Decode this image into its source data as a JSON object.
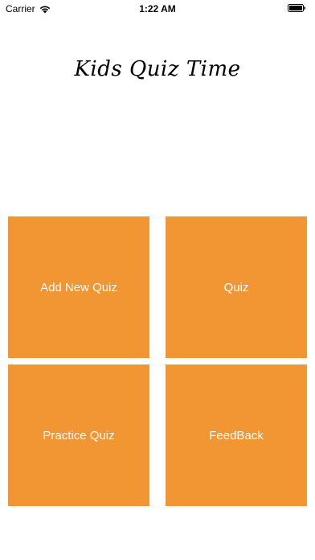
{
  "status_bar": {
    "carrier": "Carrier",
    "time": "1:22 AM",
    "wifi_icon": "wifi-icon",
    "battery_icon": "battery-icon"
  },
  "app": {
    "title": "Kids Quiz Time"
  },
  "menu": {
    "add_new_quiz": "Add New Quiz",
    "quiz": "Quiz",
    "practice_quiz": "Practice Quiz",
    "feedback": "FeedBack"
  },
  "colors": {
    "accent": "#F29533",
    "tile_text": "#FFFFFF",
    "background": "#FFFFFF"
  }
}
